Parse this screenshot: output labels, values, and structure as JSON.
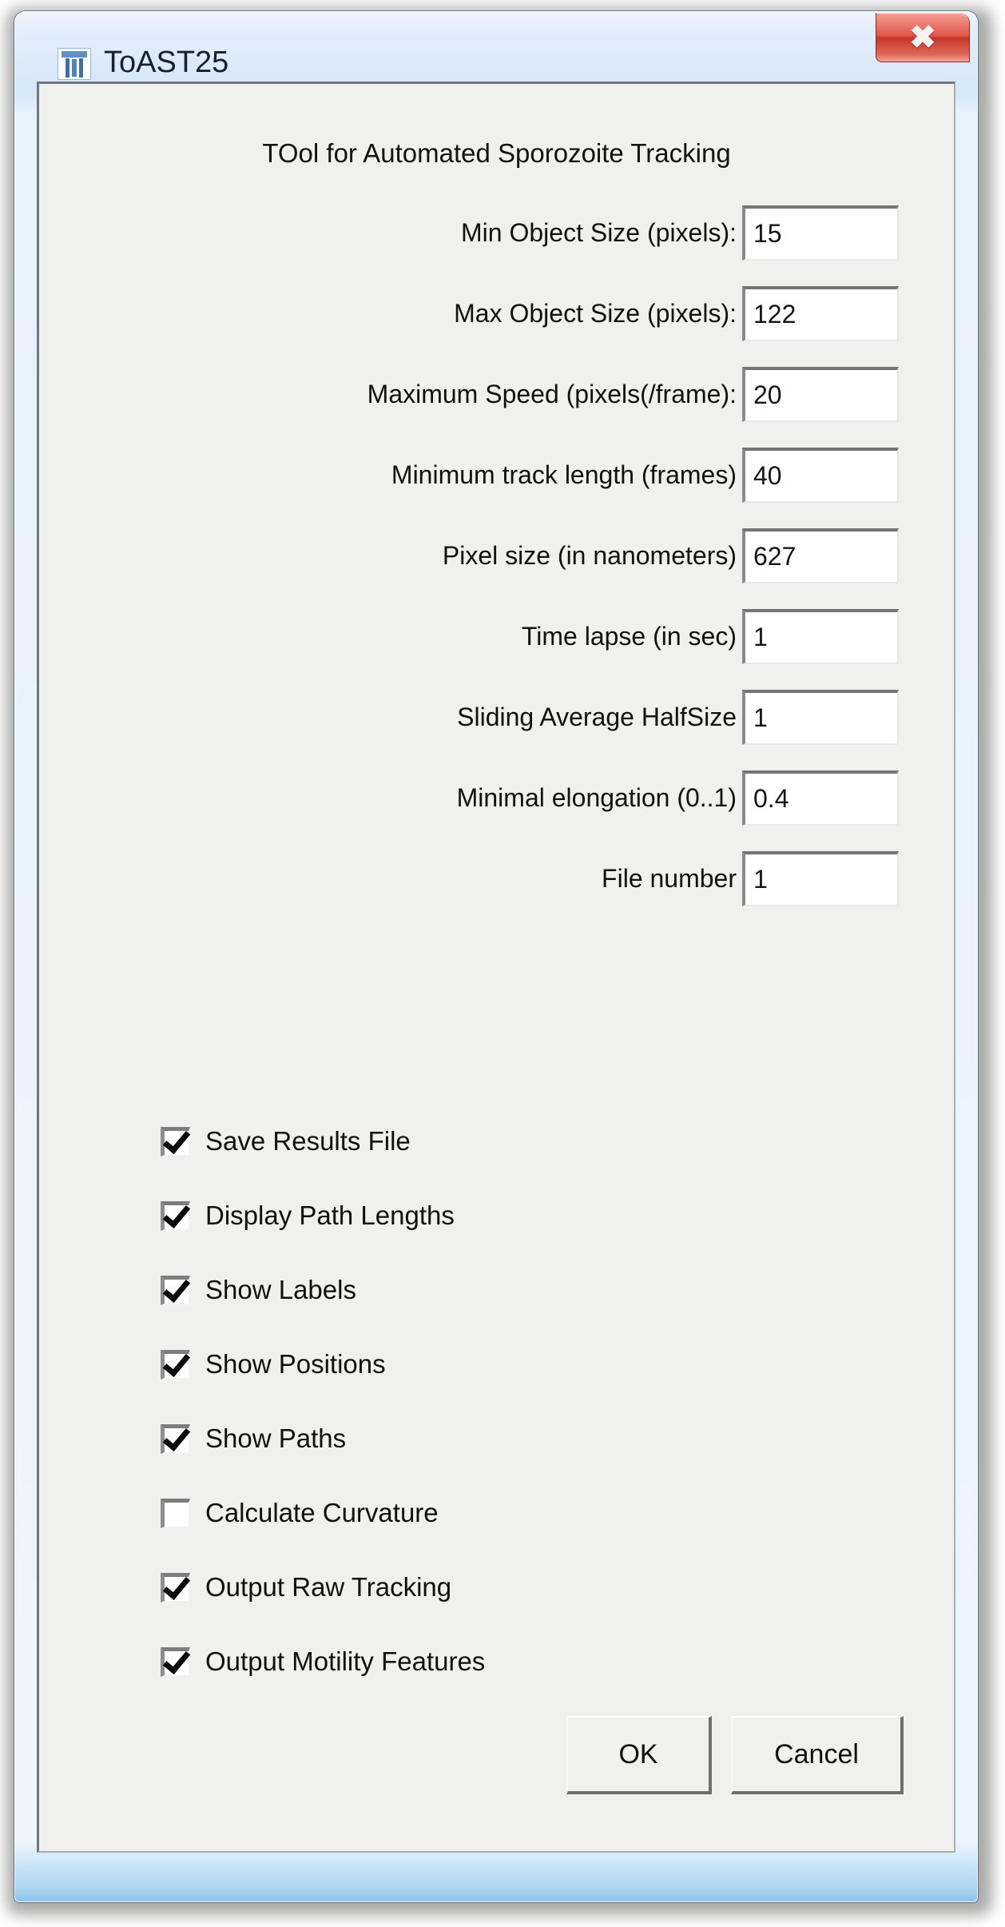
{
  "window": {
    "title": "ToAST25",
    "icon": "imagej-microscope-icon",
    "close_label": "✖",
    "frame_color": "#d6e7f8",
    "panel_color": "#f0f0ee"
  },
  "form": {
    "header": "TOol for Automated Sporozoite Tracking",
    "fields": [
      {
        "label": "Min Object Size (pixels):",
        "value": "15",
        "name": "min-object-size"
      },
      {
        "label": "Max Object Size (pixels):",
        "value": "122",
        "name": "max-object-size"
      },
      {
        "label": "Maximum Speed (pixels(/frame):",
        "value": "20",
        "name": "maximum-speed"
      },
      {
        "label": "Minimum track length (frames)",
        "value": "40",
        "name": "minimum-track-length"
      },
      {
        "label": "Pixel size (in nanometers)",
        "value": "627",
        "name": "pixel-size"
      },
      {
        "label": "Time lapse (in sec)",
        "value": "1",
        "name": "time-lapse"
      },
      {
        "label": "Sliding Average HalfSize",
        "value": "1",
        "name": "sliding-average-halfsize"
      },
      {
        "label": "Minimal elongation (0..1)",
        "value": "0.4",
        "name": "minimal-elongation"
      },
      {
        "label": "File number",
        "value": "1",
        "name": "file-number"
      }
    ],
    "checkboxes": [
      {
        "label": "Save Results File",
        "checked": true,
        "name": "save-results-file"
      },
      {
        "label": "Display Path Lengths",
        "checked": true,
        "name": "display-path-lengths"
      },
      {
        "label": "Show Labels",
        "checked": true,
        "name": "show-labels"
      },
      {
        "label": "Show Positions",
        "checked": true,
        "name": "show-positions"
      },
      {
        "label": "Show Paths",
        "checked": true,
        "name": "show-paths"
      },
      {
        "label": "Calculate Curvature",
        "checked": false,
        "name": "calculate-curvature"
      },
      {
        "label": "Output Raw Tracking",
        "checked": true,
        "name": "output-raw-tracking"
      },
      {
        "label": "Output Motility Features",
        "checked": true,
        "name": "output-motility-features"
      }
    ]
  },
  "buttons": {
    "ok": "OK",
    "cancel": "Cancel"
  }
}
